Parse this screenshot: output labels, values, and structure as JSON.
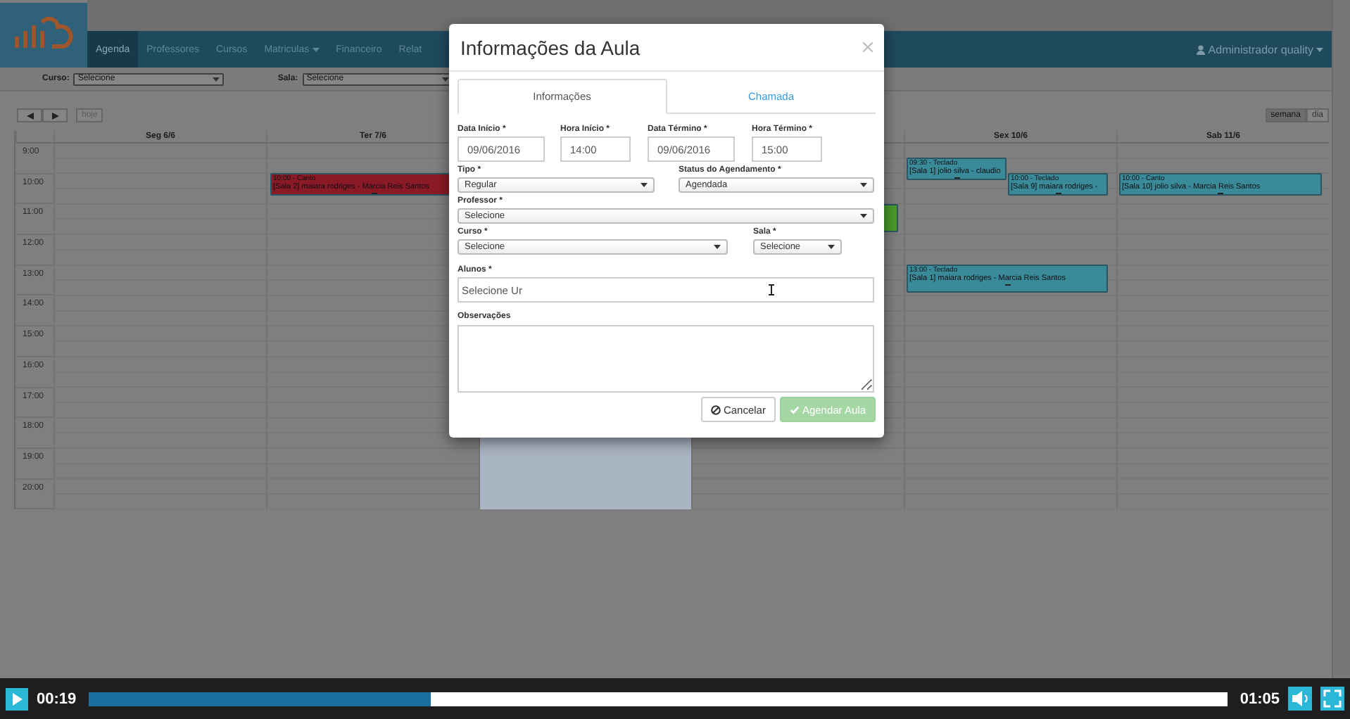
{
  "nav": {
    "items": [
      {
        "label": "Agenda",
        "selected": true,
        "dropdown": false
      },
      {
        "label": "Professores",
        "selected": false,
        "dropdown": false
      },
      {
        "label": "Cursos",
        "selected": false,
        "dropdown": false
      },
      {
        "label": "Matriculas",
        "selected": false,
        "dropdown": true
      },
      {
        "label": "Financeiro",
        "selected": false,
        "dropdown": false
      },
      {
        "label": "Relat",
        "selected": false,
        "dropdown": false
      }
    ],
    "user": "Administrador quality"
  },
  "filters": [
    {
      "label": "Curso:",
      "value": "Selecione"
    },
    {
      "label": "Sala:",
      "value": "Selecione"
    }
  ],
  "calendar": {
    "today_button": "hoje",
    "views": [
      {
        "label": "semana",
        "selected": true
      },
      {
        "label": "dia",
        "selected": false
      }
    ],
    "hours": [
      "9:00",
      "10:00",
      "11:00",
      "12:00",
      "13:00",
      "14:00",
      "15:00",
      "16:00",
      "17:00",
      "18:00",
      "19:00",
      "20:00"
    ],
    "days": [
      {
        "label": "Seg 6/6",
        "selected": false
      },
      {
        "label": "Ter 7/6",
        "selected": false,
        "events": [
          {
            "time": "10:00 - Canto",
            "details": "[Sala 2] maiara rodriges - Marcia Reis Santos",
            "color": "#8a1a26"
          }
        ]
      },
      {
        "selected": true
      },
      {
        "selected": false,
        "events": [
          {
            "color": "#4a9a2e"
          }
        ]
      },
      {
        "label": "Sex 10/6",
        "selected": false,
        "events": [
          {
            "time": "09:30 - Teclado",
            "details": "[Sala 1] jolio silva - claudio",
            "color": "#3a8a9a"
          },
          {
            "time": "10:00 - Teclado",
            "details": "[Sala 9] maiara rodriges -",
            "color": "#3a8a9a"
          },
          {
            "time": "13:00 - Teclado",
            "details": "[Sala 1] maiara rodriges - Marcia Reis Santos",
            "color": "#3a8a9a"
          }
        ]
      },
      {
        "label": "Sab 11/6",
        "selected": false,
        "events": [
          {
            "time": "10:00 - Canto",
            "details": "[Sala 10] jolio silva - Marcia Reis Santos",
            "color": "#3a8a9a"
          }
        ]
      }
    ]
  },
  "modal": {
    "title": "Informações da Aula",
    "tabs": [
      {
        "label": "Informações",
        "selected": true
      },
      {
        "label": "Chamada",
        "selected": false
      }
    ],
    "rows": [
      [
        {
          "label": "Data Início *",
          "kind": "input",
          "value": "09/06/2016"
        },
        {
          "label": "Hora Início *",
          "kind": "input",
          "value": "14:00"
        },
        {
          "label": "Data Término *",
          "kind": "input",
          "value": "09/06/2016"
        },
        {
          "label": "Hora Término *",
          "kind": "input",
          "value": "15:00"
        }
      ],
      [
        {
          "label": "Tipo *",
          "kind": "select",
          "value": "Regular"
        },
        {
          "label": "Status do Agendamento *",
          "kind": "select",
          "value": "Agendada"
        }
      ],
      [
        {
          "label": "Professor *",
          "kind": "select",
          "value": "Selecione"
        }
      ],
      [
        {
          "label": "Curso *",
          "kind": "select",
          "value": "Selecione"
        },
        {
          "label": "Sala *",
          "kind": "select",
          "value": "Selecione"
        }
      ],
      [
        {
          "label": "Alunos *",
          "kind": "input",
          "value": "Selecione Ur"
        }
      ],
      [
        {
          "label": "Observações",
          "kind": "textarea"
        }
      ]
    ],
    "buttons": [
      {
        "label": "Cancelar",
        "kind": "cancel",
        "disabled": false
      },
      {
        "label": "Agendar Aula",
        "kind": "confirm",
        "disabled": true
      }
    ]
  },
  "player": {
    "elapsed": "00:19",
    "level": 0.3,
    "duration": "01:05"
  }
}
